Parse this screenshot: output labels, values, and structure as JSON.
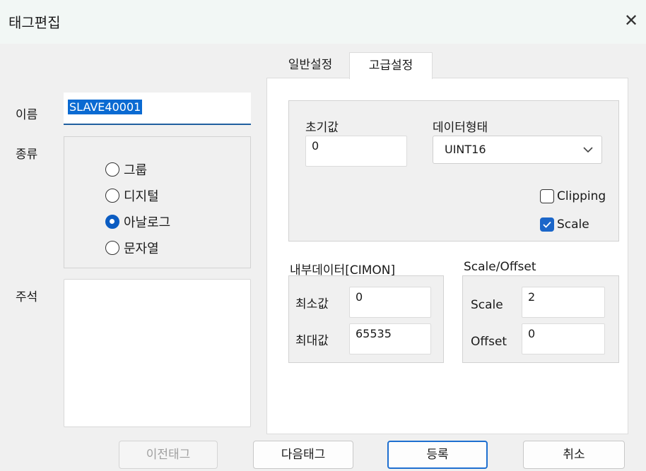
{
  "window": {
    "title": "태그편집",
    "close_glyph": "✕"
  },
  "left": {
    "name_label": "이름",
    "name_value": "SLAVE40001",
    "type_label": "종류",
    "types": [
      {
        "label": "그룹",
        "selected": false
      },
      {
        "label": "디지털",
        "selected": false
      },
      {
        "label": "아날로그",
        "selected": true
      },
      {
        "label": "문자열",
        "selected": false
      }
    ],
    "comment_label": "주석",
    "comment_value": ""
  },
  "tabs": [
    {
      "label": "일반설정",
      "active": false
    },
    {
      "label": "고급설정",
      "active": true
    }
  ],
  "advanced": {
    "initial_label": "초기값",
    "initial_value": "0",
    "datatype_label": "데이터형태",
    "datatype_value": "UINT16",
    "clipping_label": "Clipping",
    "clipping_checked": false,
    "scale_check_label": "Scale",
    "scale_checked": true,
    "internal_title": "내부데이터[CIMON]",
    "min_label": "최소값",
    "min_value": "0",
    "max_label": "최대값",
    "max_value": "65535",
    "scaleoffset_title": "Scale/Offset",
    "scale_label": "Scale",
    "scale_value": "2",
    "offset_label": "Offset",
    "offset_value": "0"
  },
  "buttons": {
    "prev": "이전태그",
    "next": "다음태그",
    "register": "등록",
    "cancel": "취소"
  },
  "colors": {
    "accent": "#1e6fd0",
    "selection": "#0a6ad2",
    "titlebar": "#f2f7f5"
  },
  "icons": {
    "close": "close-icon",
    "dropdown": "chevron-down-icon",
    "check": "check-icon"
  }
}
